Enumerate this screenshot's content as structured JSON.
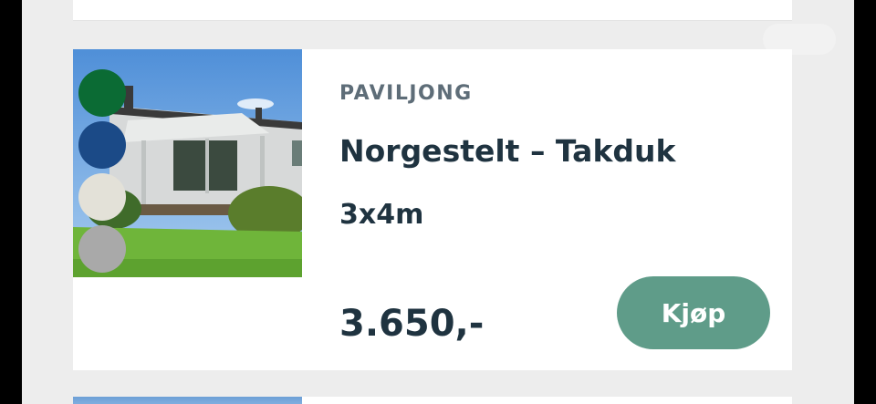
{
  "product": {
    "category": "PAVILJONG",
    "title": "Norgestelt – Takduk",
    "size": "3x4m",
    "price": "3.650,-",
    "buy_label": "Kjøp"
  },
  "color_swatches": [
    {
      "name": "green",
      "hex": "#0b6b34"
    },
    {
      "name": "blue",
      "hex": "#1b4a87"
    },
    {
      "name": "off-white",
      "hex": "#e3e1d8"
    },
    {
      "name": "grey",
      "hex": "#a9a9a9"
    }
  ],
  "accent_color": "#5f9c89"
}
